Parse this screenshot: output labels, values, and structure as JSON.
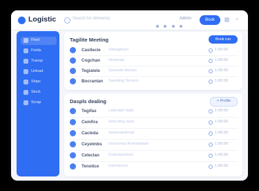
{
  "header": {
    "app_name": "Logistic",
    "search_placeholder": "Search for deliveries",
    "meta": "Admin",
    "action_button": "Book"
  },
  "sidebar": {
    "items": [
      {
        "label": "Fleet",
        "active": true
      },
      {
        "label": "Fields"
      },
      {
        "label": "Transp"
      },
      {
        "label": "Unload"
      },
      {
        "label": "Ships"
      },
      {
        "label": "Stock"
      },
      {
        "label": "Scrap"
      }
    ]
  },
  "panels": [
    {
      "title": "Tagilite Meeting",
      "button": "Book run",
      "button_style": "solid",
      "rows": [
        {
          "name": "Castlecle",
          "desc": "Swingdrum",
          "time": "1:00:00"
        },
        {
          "name": "Cogchan",
          "desc": "Hosprisp",
          "time": "1:00:00"
        },
        {
          "name": "Tegiatele",
          "desc": "Saveotis Awnon",
          "time": "1:00:00"
        },
        {
          "name": "Bocrantan",
          "desc": "Savoting Torcent",
          "time": "1:00:00"
        }
      ]
    },
    {
      "title": "Daspls dealing",
      "button": "+ Profile",
      "button_style": "ghost",
      "rows": [
        {
          "name": "Tegifas",
          "desc": "Lateratel Hate",
          "time": "1:00:00"
        },
        {
          "name": "Cemfira",
          "desc": "Selecling seas",
          "time": "1:00:00"
        },
        {
          "name": "Cacleda",
          "desc": "Sedonamional",
          "time": "1:00:00"
        },
        {
          "name": "Ceyelmbs",
          "desc": "Desconsa Romanistan",
          "time": "1:00:00"
        },
        {
          "name": "Celeclan",
          "desc": "Celeclaredom",
          "time": "1:00:00"
        },
        {
          "name": "Tenotice",
          "desc": "Intenhicom",
          "time": "1:00:00"
        }
      ]
    }
  ],
  "colors": {
    "accent": "#2f6df2",
    "background": "#f4f6fb"
  },
  "icons": {
    "logo": "logo-dot-icon",
    "search": "search-icon",
    "row": "avatar-icon",
    "time": "clock-icon"
  }
}
